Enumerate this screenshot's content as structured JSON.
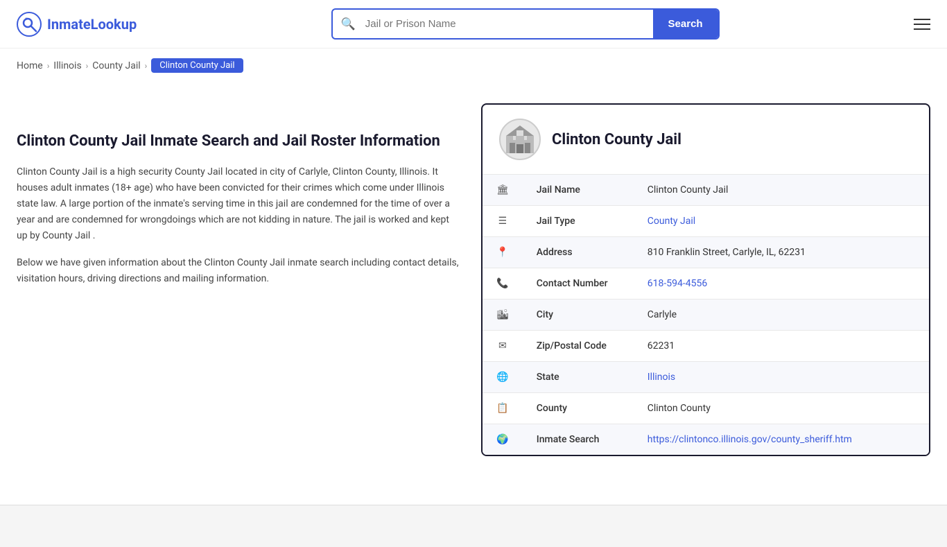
{
  "header": {
    "logo_text_1": "Inmate",
    "logo_text_2": "Lookup",
    "search_placeholder": "Jail or Prison Name",
    "search_button_label": "Search"
  },
  "breadcrumb": {
    "home": "Home",
    "step2": "Illinois",
    "step3": "County Jail",
    "current": "Clinton County Jail"
  },
  "left": {
    "heading": "Clinton County Jail Inmate Search and Jail Roster Information",
    "para1": "Clinton County Jail is a high security County Jail located in city of Carlyle, Clinton County, Illinois. It houses adult inmates (18+ age) who have been convicted for their crimes which come under Illinois state law. A large portion of the inmate's serving time in this jail are condemned for the time of over a year and are condemned for wrongdoings which are not kidding in nature. The jail is worked and kept up by County Jail .",
    "para2": "Below we have given information about the Clinton County Jail inmate search including contact details, visitation hours, driving directions and mailing information."
  },
  "card": {
    "title": "Clinton County Jail",
    "rows": [
      {
        "icon": "🏛",
        "label": "Jail Name",
        "value": "Clinton County Jail",
        "link": null
      },
      {
        "icon": "☰",
        "label": "Jail Type",
        "value": "County Jail",
        "link": "#"
      },
      {
        "icon": "📍",
        "label": "Address",
        "value": "810 Franklin Street, Carlyle, IL, 62231",
        "link": null
      },
      {
        "icon": "📞",
        "label": "Contact Number",
        "value": "618-594-4556",
        "link": "tel:618-594-4556"
      },
      {
        "icon": "🏙",
        "label": "City",
        "value": "Carlyle",
        "link": null
      },
      {
        "icon": "✉",
        "label": "Zip/Postal Code",
        "value": "62231",
        "link": null
      },
      {
        "icon": "🌐",
        "label": "State",
        "value": "Illinois",
        "link": "#"
      },
      {
        "icon": "📋",
        "label": "County",
        "value": "Clinton County",
        "link": null
      },
      {
        "icon": "🌍",
        "label": "Inmate Search",
        "value": "https://clintonco.illinois.gov/county_sheriff.htm",
        "link": "https://clintonco.illinois.gov/county_sheriff.htm"
      }
    ]
  },
  "icons": {
    "search": "🔍",
    "menu": "≡"
  }
}
